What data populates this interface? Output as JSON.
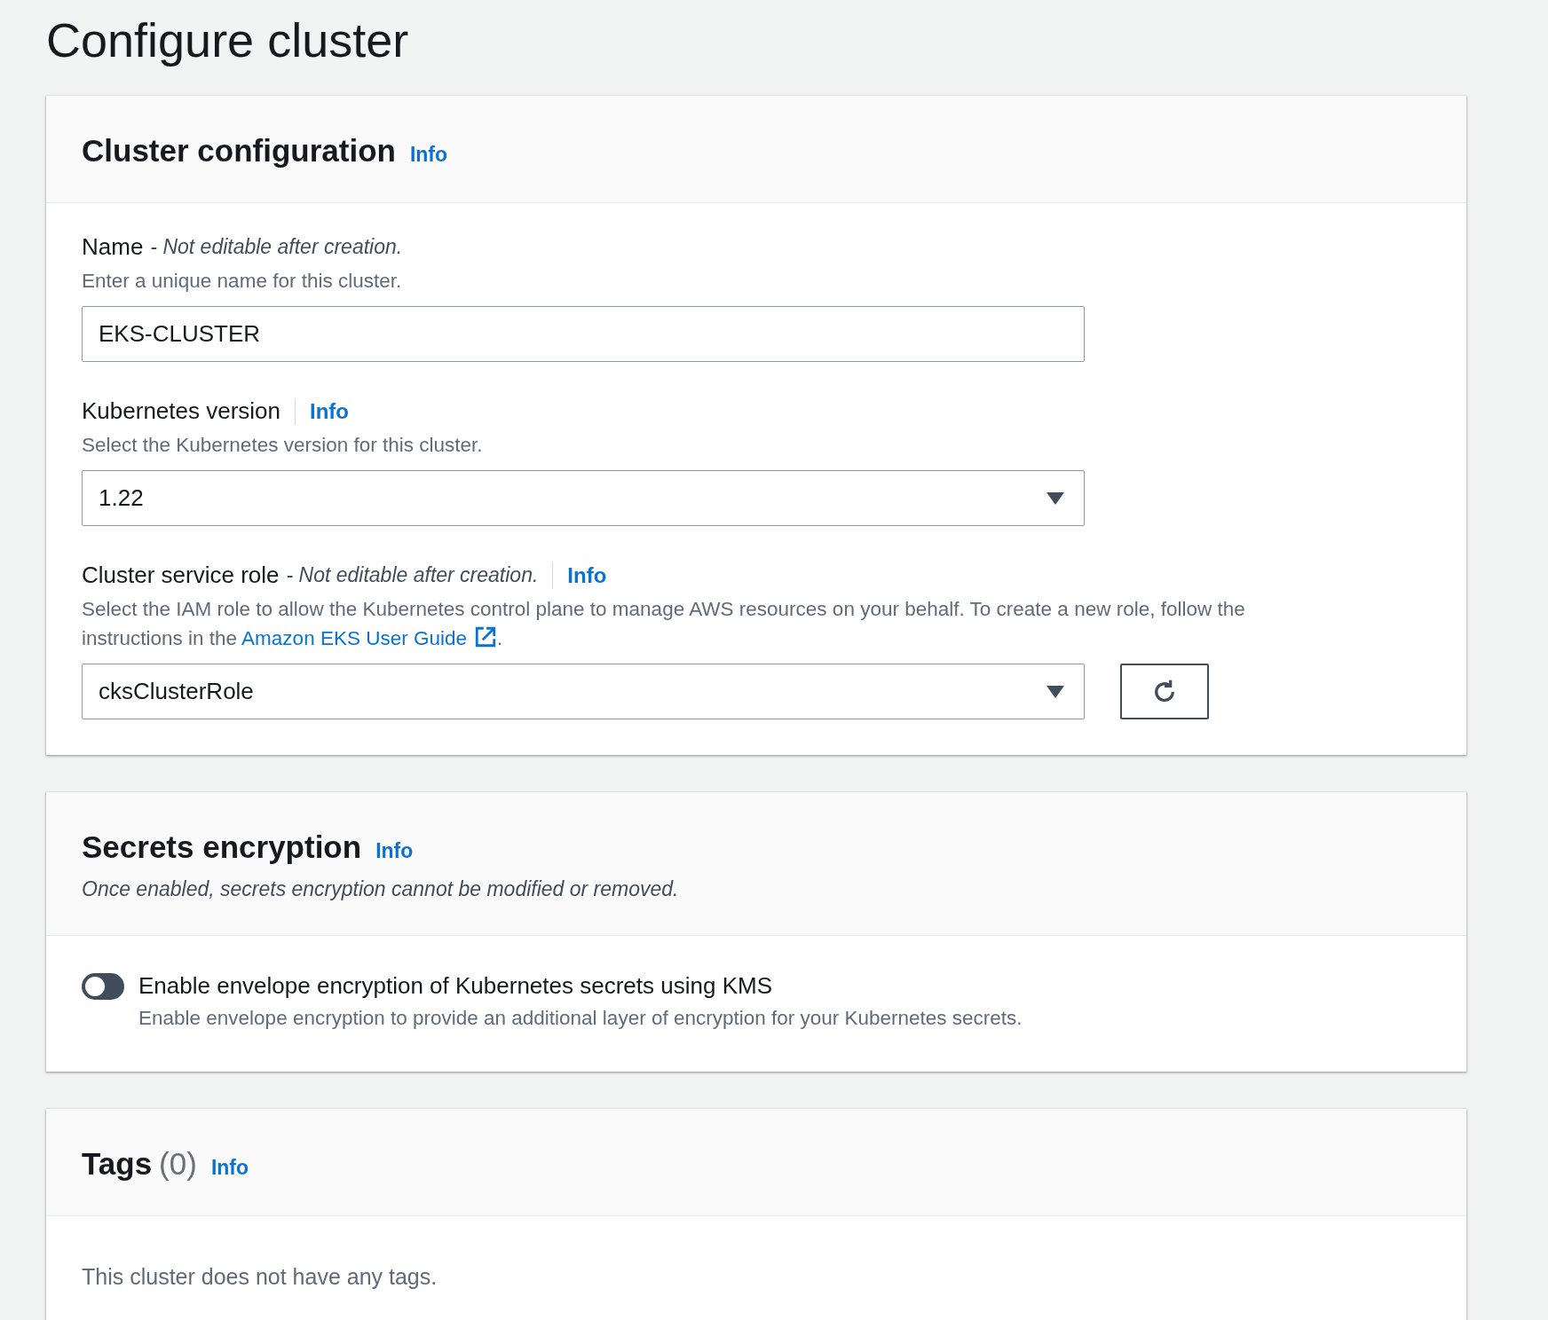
{
  "page_title": "Configure cluster",
  "cluster_configuration": {
    "title": "Cluster configuration",
    "info": "Info",
    "fields": [
      {
        "kind": "text",
        "label": "Name",
        "constraint": "- Not editable after creation.",
        "description": "Enter a unique name for this cluster.",
        "value": "EKS-CLUSTER"
      },
      {
        "kind": "select",
        "label": "Kubernetes version",
        "info": "Info",
        "description": "Select the Kubernetes version for this cluster.",
        "value": "1.22"
      },
      {
        "kind": "select_refresh",
        "label": "Cluster service role",
        "constraint": "- Not editable after creation.",
        "info": "Info",
        "description": "Select the IAM role to allow the Kubernetes control plane to manage AWS resources on your behalf. To create a new role, follow the instructions in the ",
        "link": "Amazon EKS User Guide",
        "description_end": ".",
        "value": "cksClusterRole"
      }
    ]
  },
  "secrets_encryption": {
    "title": "Secrets encryption",
    "info": "Info",
    "subtitle": "Once enabled, secrets encryption cannot be modified or removed.",
    "toggle": {
      "on": false,
      "label": "Enable envelope encryption of Kubernetes secrets using KMS",
      "description": "Enable envelope encryption to provide an additional layer of encryption for your Kubernetes secrets."
    }
  },
  "tags": {
    "title": "Tags",
    "count": "(0)",
    "info": "Info",
    "empty_text": "This cluster does not have any tags."
  }
}
